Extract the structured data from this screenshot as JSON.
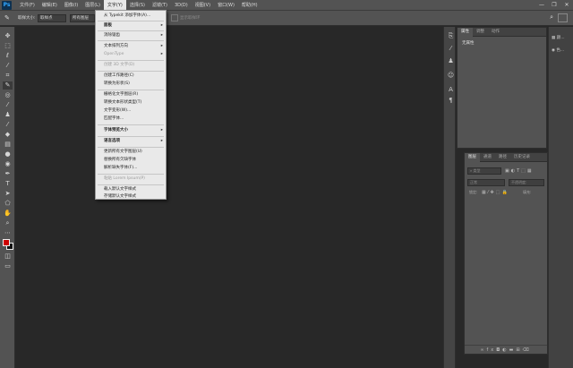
{
  "app": {
    "logo": "Ps"
  },
  "menubar": {
    "items": [
      "文件(F)",
      "编辑(E)",
      "图像(I)",
      "图层(L)",
      "文字(Y)",
      "选择(S)",
      "滤镜(T)",
      "3D(D)",
      "视图(V)",
      "窗口(W)",
      "帮助(H)"
    ],
    "active_index": 4
  },
  "window_controls": {
    "minimize": "—",
    "restore": "❐",
    "close": "✕"
  },
  "options_bar": {
    "label": "取样大小:",
    "sample_size": "取样点",
    "sample_mode": "所有图层",
    "checkbox_label": "显示取样环"
  },
  "dropdown": {
    "items": [
      {
        "label": "从 Typekit 添加字体(A)...",
        "enabled": true,
        "bold": false,
        "submenu": false
      },
      {
        "label": "面板",
        "enabled": true,
        "bold": true,
        "submenu": true
      },
      {
        "label": "消除锯齿",
        "enabled": true,
        "bold": false,
        "submenu": true
      },
      {
        "label": "文本排列方向",
        "enabled": true,
        "bold": false,
        "submenu": true
      },
      {
        "label": "OpenType",
        "enabled": false,
        "bold": false,
        "submenu": true
      },
      {
        "label": "创建 3D 文字(D)",
        "enabled": false,
        "bold": false,
        "submenu": false
      },
      {
        "label": "创建工作路径(C)",
        "enabled": true,
        "bold": false,
        "submenu": false
      },
      {
        "label": "转换为形状(S)",
        "enabled": true,
        "bold": false,
        "submenu": false
      },
      {
        "label": "栅格化文字图层(R)",
        "enabled": true,
        "bold": false,
        "submenu": false
      },
      {
        "label": "转换文本形状类型(T)",
        "enabled": true,
        "bold": false,
        "submenu": false
      },
      {
        "label": "文字变形(W)...",
        "enabled": true,
        "bold": false,
        "submenu": false
      },
      {
        "label": "匹配字体...",
        "enabled": true,
        "bold": false,
        "submenu": false
      },
      {
        "label": "字体预览大小",
        "enabled": true,
        "bold": true,
        "submenu": true
      },
      {
        "label": "语言选项",
        "enabled": true,
        "bold": true,
        "submenu": true
      },
      {
        "label": "更新所有文字图层(U)",
        "enabled": true,
        "bold": false,
        "submenu": false
      },
      {
        "label": "替换所有欠缺字体",
        "enabled": true,
        "bold": false,
        "submenu": false
      },
      {
        "label": "解析缺失字体(F)...",
        "enabled": true,
        "bold": false,
        "submenu": false
      },
      {
        "label": "粘贴 Lorem Ipsum(P)",
        "enabled": false,
        "bold": false,
        "submenu": false
      },
      {
        "label": "载入默认文字样式",
        "enabled": true,
        "bold": false,
        "submenu": false
      },
      {
        "label": "存储默认文字样式",
        "enabled": true,
        "bold": false,
        "submenu": false
      }
    ]
  },
  "properties_panel": {
    "tabs": [
      "属性",
      "调整",
      "动作"
    ],
    "active_tab": 0,
    "content": "无属性"
  },
  "side_panel": {
    "items": [
      {
        "icon": "color-icon",
        "label": "颜..."
      },
      {
        "icon": "swatches-icon",
        "label": "色..."
      }
    ]
  },
  "layers_panel": {
    "tabs": [
      "图层",
      "通道",
      "路径",
      "历史记录"
    ],
    "active_tab": 0,
    "filter_placeholder": "类型",
    "blend_mode": "正常",
    "opacity_label": "不透明度:",
    "lock_label": "锁定:",
    "fill_label": "填充:"
  }
}
